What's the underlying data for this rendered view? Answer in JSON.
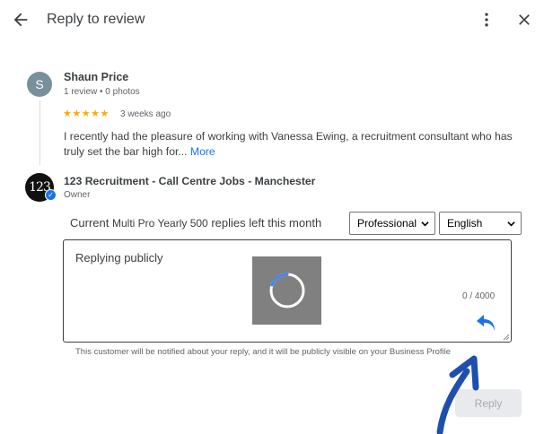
{
  "header": {
    "title": "Reply to review"
  },
  "review": {
    "avatar_letter": "S",
    "reviewer_name": "Shaun Price",
    "reviewer_meta": "1 review • 0 photos",
    "stars": "★★★★★",
    "rating": 5,
    "time": "3 weeks ago",
    "text": "I recently had the pleasure of working with Vanessa Ewing, a recruitment consultant who has truly set the bar high for...",
    "more_label": "More"
  },
  "business": {
    "logo_text": "123",
    "name": "123 Recruitment - Call Centre Jobs - Manchester",
    "role": "Owner"
  },
  "quota": {
    "prefix": "Current",
    "plan": "Multi Pro Yearly 500",
    "suffix": "replies left this month"
  },
  "selects": {
    "tone": "Professional",
    "language": "English"
  },
  "reply": {
    "placeholder": "Replying publicly",
    "char_count": "0 / 4000"
  },
  "notice": "This customer will be notified about your reply, and it will be publicly visible on your Business Profile",
  "actions": {
    "reply_label": "Reply"
  },
  "colors": {
    "accent": "#1a73e8",
    "star": "#f9ab00",
    "annotation_arrow": "#1f4fae",
    "undo_icon": "#1a73e8"
  }
}
